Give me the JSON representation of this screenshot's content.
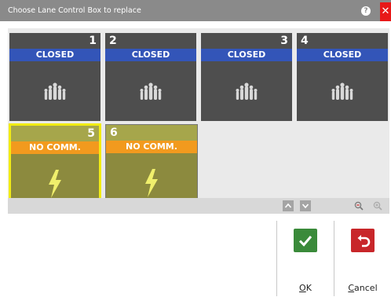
{
  "window": {
    "title": "Choose Lane Control Box to replace",
    "help_label": "?",
    "close_label": "✕"
  },
  "lanes": [
    {
      "number": "1",
      "status": "CLOSED",
      "icon": "bowling-pins-icon"
    },
    {
      "number": "2",
      "status": "CLOSED",
      "icon": "bowling-pins-icon"
    },
    {
      "number": "3",
      "status": "CLOSED",
      "icon": "bowling-pins-icon"
    },
    {
      "number": "4",
      "status": "CLOSED",
      "icon": "bowling-pins-icon"
    },
    {
      "number": "5",
      "status": "NO COMM.",
      "icon": "lightning-icon",
      "selected": true
    },
    {
      "number": "6",
      "status": "NO COMM.",
      "icon": "lightning-icon"
    }
  ],
  "scroll": {
    "up_icon": "chevron-up-icon",
    "down_icon": "chevron-down-icon",
    "zoom_out_icon": "zoom-out-icon",
    "zoom_in_icon": "zoom-in-icon"
  },
  "buttons": {
    "ok_label_underlined": "O",
    "ok_label_rest": "K",
    "cancel_label_underlined": "C",
    "cancel_label_rest": "ancel"
  },
  "colors": {
    "closed_status": "#3355b8",
    "nocomm_status": "#f29a1e",
    "nocomm_tile": "#8c8a3e",
    "selected_border": "#f2ec10",
    "ok_button": "#3a8a3a",
    "cancel_button": "#c8262a"
  }
}
